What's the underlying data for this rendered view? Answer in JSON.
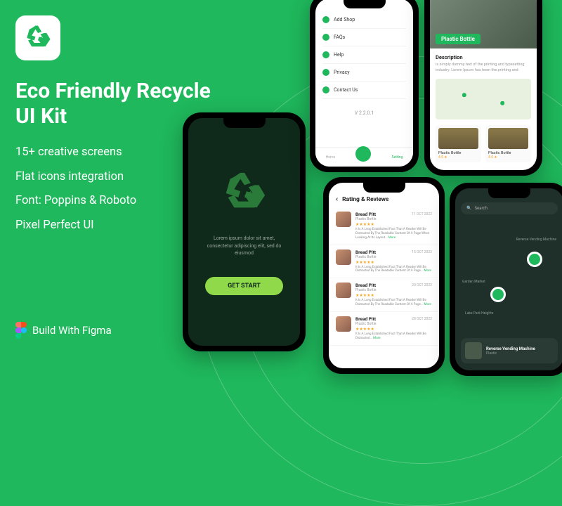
{
  "headline_l1": "Eco Friendly Recycle",
  "headline_l2": "UI Kit",
  "features": {
    "f1": "15+ creative screens",
    "f2": "Flat icons integration",
    "f3": "Font: Poppins & Roboto",
    "f4": "Pixel Perfect UI"
  },
  "figma_label": "Build With Figma",
  "main_phone": {
    "lorem": "Lorem ipsum dolor sit amet, consectetur adipiscing elit, sed do eiusmod",
    "cta": "GET START"
  },
  "settings": {
    "items": [
      "Add Shop",
      "FAQs",
      "Help",
      "Privacy",
      "Contact Us"
    ],
    "version": "V 2.2.0.1",
    "nav": {
      "home": "Home",
      "setting": "Setting"
    }
  },
  "detail": {
    "title": "Plastic Bottle",
    "desc_h": "Description",
    "desc_p": "is simply dummy text of the printing and typesetting industry. Lorem Ipsum has been the printing and",
    "card1": {
      "title": "Plastic Bottle",
      "rating": "4.5 ★"
    },
    "card2": {
      "title": "Plastic Bottle",
      "rating": "4.5 ★"
    }
  },
  "reviews": {
    "heading": "Rating & Reviews",
    "items": [
      {
        "name": "Bread Pitt",
        "sub": "Plastic Bottle",
        "date": "11 OCT 2022",
        "stars": "★★★★★",
        "text": "It Is A Long Established Fact That A Reader Will Be Distracted By The Readable Content Of A Page When Looking At Its Layout... More"
      },
      {
        "name": "Bread Pitt",
        "sub": "Plastic Bottle",
        "date": "15 OCT 2022",
        "stars": "★★★★★",
        "text": "It Is A Long Established Fact That A Reader Will Be Distracted By The Readable Content Of A Page... More"
      },
      {
        "name": "Bread Pitt",
        "sub": "Plastic Bottle",
        "date": "20 OCT 2022",
        "stars": "★★★★★",
        "text": "It Is A Long Established Fact That A Reader Will Be Distracted By The Readable Content Of A Page... More"
      },
      {
        "name": "Bread Pitt",
        "sub": "Plastic Bottle",
        "date": "28 OCT 2022",
        "stars": "★★★★★",
        "text": "It Is A Long Established Fact That A Reader Will Be Distracted... More"
      }
    ]
  },
  "map": {
    "search": "Search",
    "label1": "Reverse Vending Machine",
    "label2": "Garden Market",
    "label3": "Lake Park Heights",
    "card_title": "Reverse Vending Machine",
    "card_sub": "Plastic"
  }
}
